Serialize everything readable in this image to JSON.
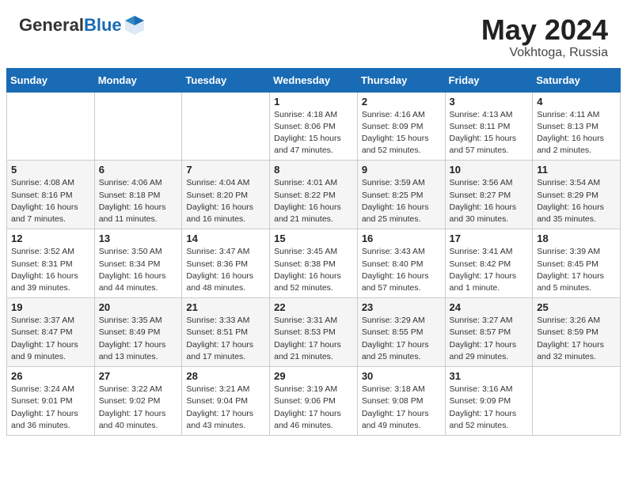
{
  "header": {
    "logo_general": "General",
    "logo_blue": "Blue",
    "title_month": "May 2024",
    "title_location": "Vokhtoga, Russia"
  },
  "calendar": {
    "days_of_week": [
      "Sunday",
      "Monday",
      "Tuesday",
      "Wednesday",
      "Thursday",
      "Friday",
      "Saturday"
    ],
    "weeks": [
      [
        {
          "day": "",
          "info": ""
        },
        {
          "day": "",
          "info": ""
        },
        {
          "day": "",
          "info": ""
        },
        {
          "day": "1",
          "info": "Sunrise: 4:18 AM\nSunset: 8:06 PM\nDaylight: 15 hours\nand 47 minutes."
        },
        {
          "day": "2",
          "info": "Sunrise: 4:16 AM\nSunset: 8:09 PM\nDaylight: 15 hours\nand 52 minutes."
        },
        {
          "day": "3",
          "info": "Sunrise: 4:13 AM\nSunset: 8:11 PM\nDaylight: 15 hours\nand 57 minutes."
        },
        {
          "day": "4",
          "info": "Sunrise: 4:11 AM\nSunset: 8:13 PM\nDaylight: 16 hours\nand 2 minutes."
        }
      ],
      [
        {
          "day": "5",
          "info": "Sunrise: 4:08 AM\nSunset: 8:16 PM\nDaylight: 16 hours\nand 7 minutes."
        },
        {
          "day": "6",
          "info": "Sunrise: 4:06 AM\nSunset: 8:18 PM\nDaylight: 16 hours\nand 11 minutes."
        },
        {
          "day": "7",
          "info": "Sunrise: 4:04 AM\nSunset: 8:20 PM\nDaylight: 16 hours\nand 16 minutes."
        },
        {
          "day": "8",
          "info": "Sunrise: 4:01 AM\nSunset: 8:22 PM\nDaylight: 16 hours\nand 21 minutes."
        },
        {
          "day": "9",
          "info": "Sunrise: 3:59 AM\nSunset: 8:25 PM\nDaylight: 16 hours\nand 25 minutes."
        },
        {
          "day": "10",
          "info": "Sunrise: 3:56 AM\nSunset: 8:27 PM\nDaylight: 16 hours\nand 30 minutes."
        },
        {
          "day": "11",
          "info": "Sunrise: 3:54 AM\nSunset: 8:29 PM\nDaylight: 16 hours\nand 35 minutes."
        }
      ],
      [
        {
          "day": "12",
          "info": "Sunrise: 3:52 AM\nSunset: 8:31 PM\nDaylight: 16 hours\nand 39 minutes."
        },
        {
          "day": "13",
          "info": "Sunrise: 3:50 AM\nSunset: 8:34 PM\nDaylight: 16 hours\nand 44 minutes."
        },
        {
          "day": "14",
          "info": "Sunrise: 3:47 AM\nSunset: 8:36 PM\nDaylight: 16 hours\nand 48 minutes."
        },
        {
          "day": "15",
          "info": "Sunrise: 3:45 AM\nSunset: 8:38 PM\nDaylight: 16 hours\nand 52 minutes."
        },
        {
          "day": "16",
          "info": "Sunrise: 3:43 AM\nSunset: 8:40 PM\nDaylight: 16 hours\nand 57 minutes."
        },
        {
          "day": "17",
          "info": "Sunrise: 3:41 AM\nSunset: 8:42 PM\nDaylight: 17 hours\nand 1 minute."
        },
        {
          "day": "18",
          "info": "Sunrise: 3:39 AM\nSunset: 8:45 PM\nDaylight: 17 hours\nand 5 minutes."
        }
      ],
      [
        {
          "day": "19",
          "info": "Sunrise: 3:37 AM\nSunset: 8:47 PM\nDaylight: 17 hours\nand 9 minutes."
        },
        {
          "day": "20",
          "info": "Sunrise: 3:35 AM\nSunset: 8:49 PM\nDaylight: 17 hours\nand 13 minutes."
        },
        {
          "day": "21",
          "info": "Sunrise: 3:33 AM\nSunset: 8:51 PM\nDaylight: 17 hours\nand 17 minutes."
        },
        {
          "day": "22",
          "info": "Sunrise: 3:31 AM\nSunset: 8:53 PM\nDaylight: 17 hours\nand 21 minutes."
        },
        {
          "day": "23",
          "info": "Sunrise: 3:29 AM\nSunset: 8:55 PM\nDaylight: 17 hours\nand 25 minutes."
        },
        {
          "day": "24",
          "info": "Sunrise: 3:27 AM\nSunset: 8:57 PM\nDaylight: 17 hours\nand 29 minutes."
        },
        {
          "day": "25",
          "info": "Sunrise: 3:26 AM\nSunset: 8:59 PM\nDaylight: 17 hours\nand 32 minutes."
        }
      ],
      [
        {
          "day": "26",
          "info": "Sunrise: 3:24 AM\nSunset: 9:01 PM\nDaylight: 17 hours\nand 36 minutes."
        },
        {
          "day": "27",
          "info": "Sunrise: 3:22 AM\nSunset: 9:02 PM\nDaylight: 17 hours\nand 40 minutes."
        },
        {
          "day": "28",
          "info": "Sunrise: 3:21 AM\nSunset: 9:04 PM\nDaylight: 17 hours\nand 43 minutes."
        },
        {
          "day": "29",
          "info": "Sunrise: 3:19 AM\nSunset: 9:06 PM\nDaylight: 17 hours\nand 46 minutes."
        },
        {
          "day": "30",
          "info": "Sunrise: 3:18 AM\nSunset: 9:08 PM\nDaylight: 17 hours\nand 49 minutes."
        },
        {
          "day": "31",
          "info": "Sunrise: 3:16 AM\nSunset: 9:09 PM\nDaylight: 17 hours\nand 52 minutes."
        },
        {
          "day": "",
          "info": ""
        }
      ]
    ]
  }
}
